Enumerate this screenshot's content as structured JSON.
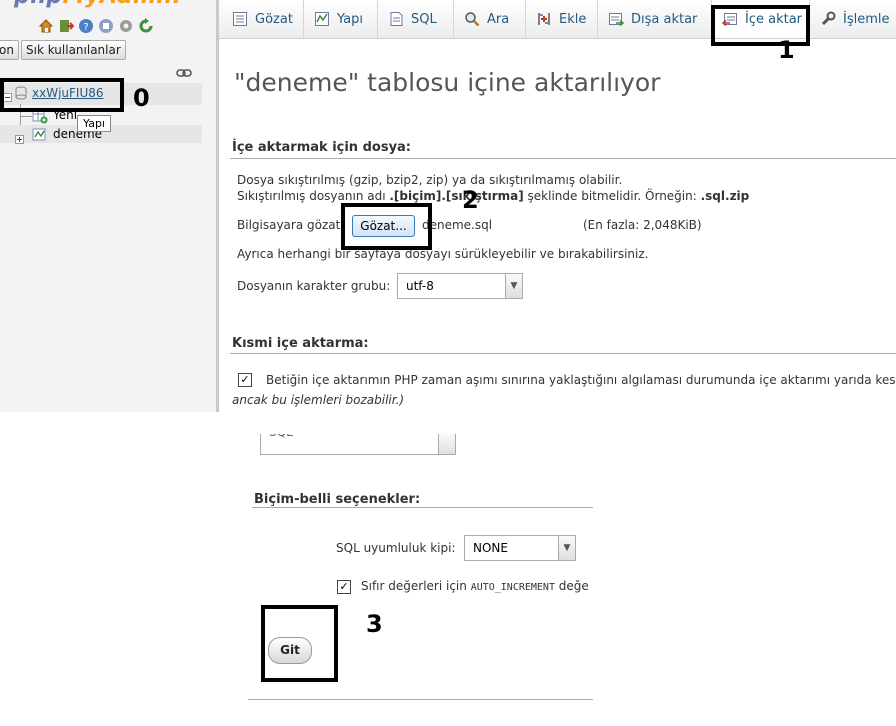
{
  "nav": {
    "logo_prefix": "php",
    "logo_suffix": "MyAdmin",
    "tab_partial": "on",
    "tab_recent": "Sık kullanılanlar",
    "db_name": "xxWjuFIU86",
    "tree_new": "Yeni",
    "tree_table": "deneme",
    "tooltip": "Yapı"
  },
  "tabs": [
    {
      "label": "Gözat",
      "icon": "browse-icon"
    },
    {
      "label": "Yapı",
      "icon": "structure-icon"
    },
    {
      "label": "SQL",
      "icon": "sql-icon"
    },
    {
      "label": "Ara",
      "icon": "search-icon"
    },
    {
      "label": "Ekle",
      "icon": "insert-icon"
    },
    {
      "label": "Dışa aktar",
      "icon": "export-icon"
    },
    {
      "label": "İçe aktar",
      "icon": "import-icon"
    },
    {
      "label": "İşlemle",
      "icon": "wrench-icon"
    }
  ],
  "main": {
    "title": "\"deneme\" tablosu içine aktarılıyor",
    "file_section": {
      "legend": "İçe aktarmak için dosya:",
      "line1": "Dosya sıkıştırılmış (gzip, bzip2, zip) ya da sıkıştırılmamış olabilir.",
      "line2_a": "Sıkıştırılmış dosyanın adı ",
      "line2_b": ".[biçim].[sıkıştırma]",
      "line2_c": " şeklinde bitmelidir. Örneğin: ",
      "line2_d": ".sql.zip",
      "browse_label": "Bilgisayara gözat:",
      "browse_button": "Gözat...",
      "file_name": "deneme.sql",
      "max_size": "(En fazla: 2,048KiB)",
      "drag_hint": "Ayrıca herhangi bir sayfaya dosyayı sürükleyebilir ve bırakabilirsiniz.",
      "charset_label": "Dosyanın karakter grubu:",
      "charset_value": "utf-8"
    },
    "partial_section": {
      "legend": "Kısmi içe aktarma:",
      "checkbox_text": "Betiğin içe aktarımın PHP zaman aşımı sınırına yaklaştığını algılaması durumunda içe aktarımı yarıda kesmey",
      "italic_text": "ancak bu işlemleri bozabilir.)"
    },
    "format_value": "SQL",
    "format_section": {
      "legend": "Biçim-belli seçenekler:",
      "compat_label": "SQL uyumluluk kipi:",
      "compat_value": "NONE",
      "zero_text_a": "Sıfır değerleri için ",
      "zero_text_mono": "AUTO_INCREMENT",
      "zero_text_b": " değe"
    },
    "go_button": "Git"
  },
  "annotations": {
    "n0": "0",
    "n1": "1",
    "n2": "2",
    "n3": "3"
  }
}
